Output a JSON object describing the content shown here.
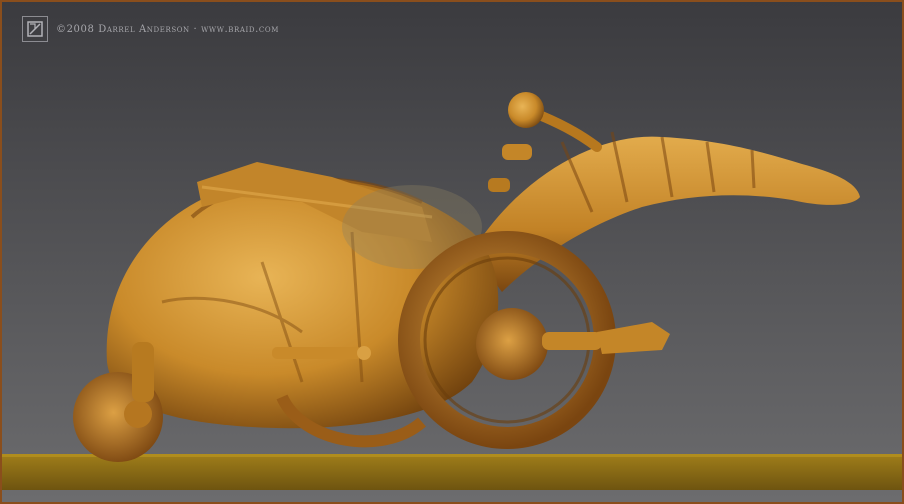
{
  "image": {
    "description_hidden": "",
    "watermark": {
      "credit_text": "©2008 Darrel Anderson · www.braid.com",
      "logo_icon": "braid-logo-icon"
    },
    "colors": {
      "border": "#8a4e1c",
      "background_top": "#3b3b3f",
      "background_bottom": "#6c6c6e",
      "model_gold": "#c98a2a",
      "model_highlight": "#e8b456",
      "model_shadow": "#6b3d0c",
      "ground": "#8a6a14"
    }
  }
}
